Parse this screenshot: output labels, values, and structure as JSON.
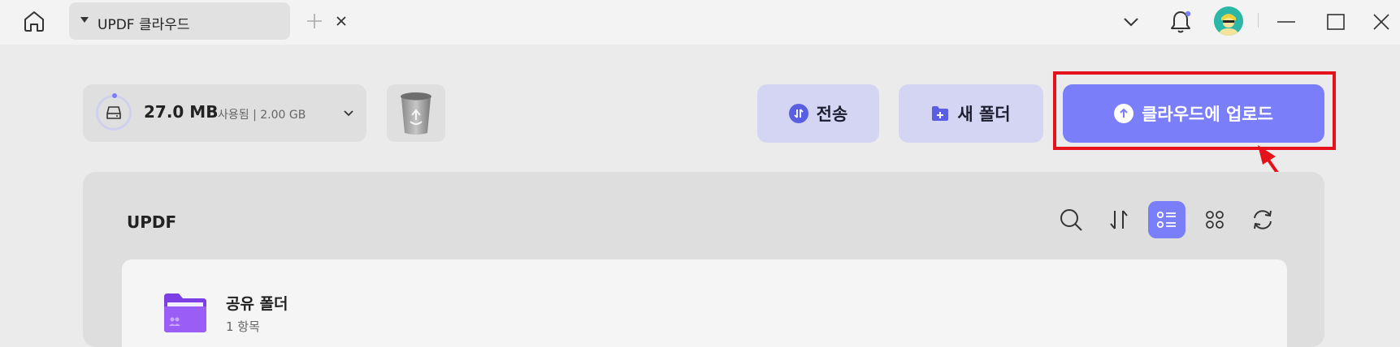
{
  "titlebar": {
    "tab_label": "UPDF 클라우드",
    "home_icon": "home-icon",
    "close_icon": "close-icon",
    "new_tab_icon": "plus-icon"
  },
  "storage": {
    "used": "27.0 MB",
    "total": "사용됨 | 2.00 GB"
  },
  "actions": {
    "transfer": "전송",
    "new_folder": "새 폴더",
    "upload": "클라우드에 업로드"
  },
  "panel": {
    "title": "UPDF",
    "items": [
      {
        "name": "공유 폴더",
        "count": "1 항목"
      }
    ]
  },
  "colors": {
    "accent": "#7a7ef8",
    "secondary_button": "#d4d5f3",
    "highlight": "#e3121b",
    "folder": "#8a4cf0"
  }
}
